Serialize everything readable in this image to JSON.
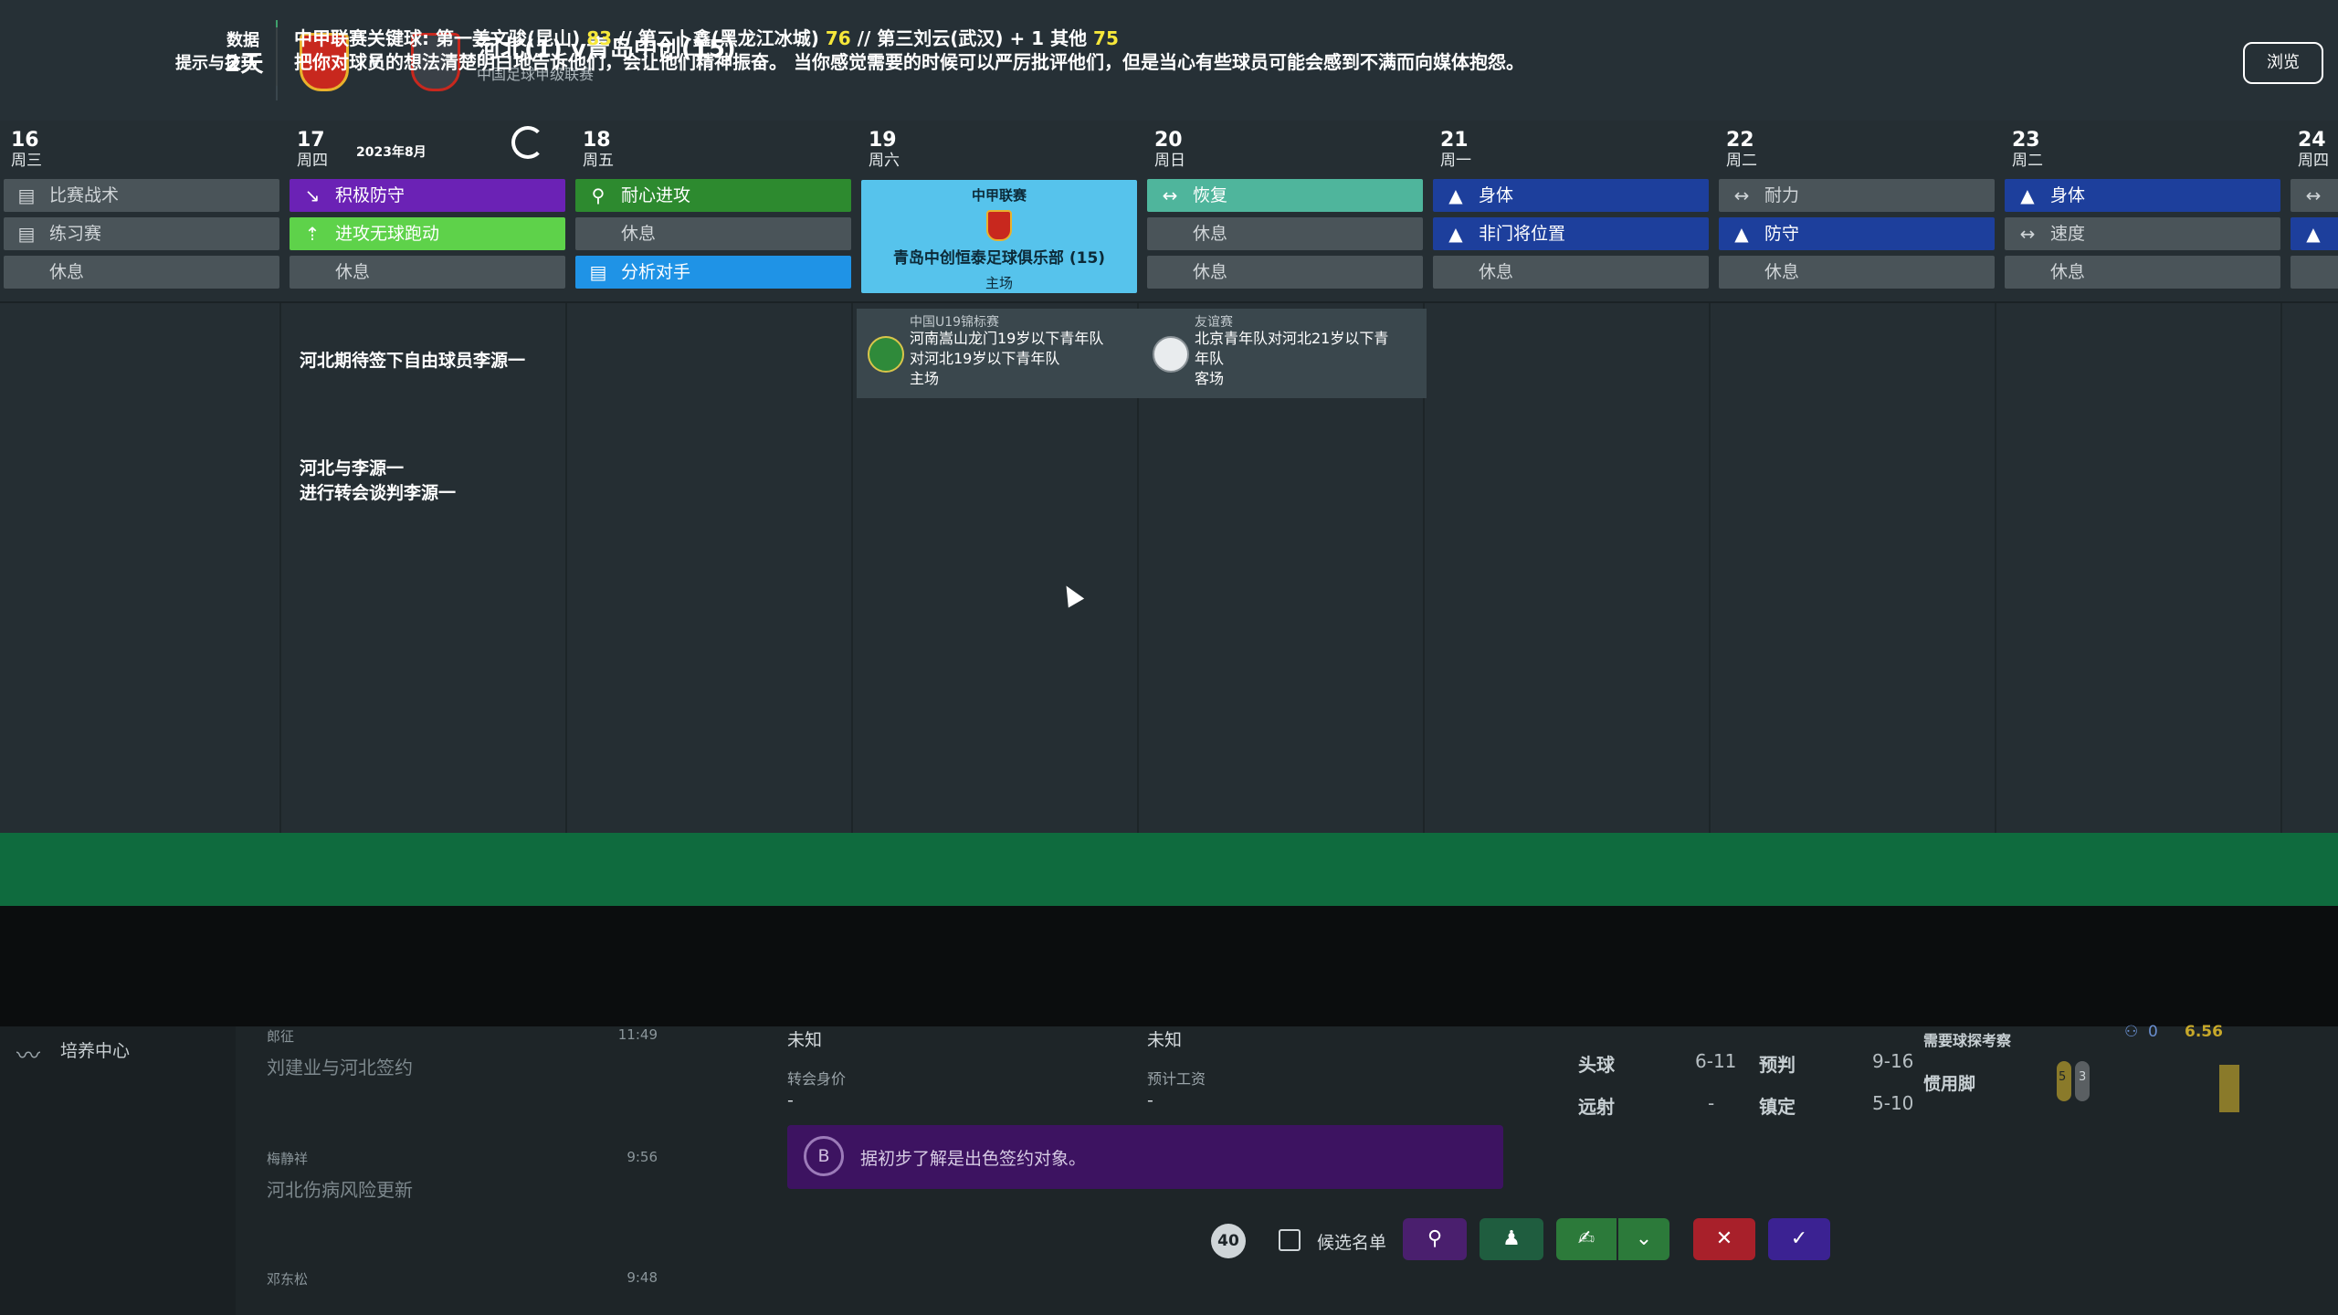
{
  "header": {
    "days_left": "2天",
    "vs": "v",
    "match_title": "河北(1) v青岛中创(15)",
    "league": "中国足球甲级联赛",
    "browse": "浏览",
    "month_label": "2023年8月"
  },
  "calendar": {
    "days": [
      {
        "num": "16",
        "week": "周三",
        "slots": [
          {
            "icon": "clipboard-icon",
            "glyph": "▤",
            "label": "比赛战术",
            "color": "gray"
          },
          {
            "icon": "clipboard-icon",
            "glyph": "▤",
            "label": "练习赛",
            "color": "gray"
          },
          {
            "icon": "",
            "glyph": "",
            "label": "休息",
            "color": "gray"
          }
        ]
      },
      {
        "num": "17",
        "week": "周四",
        "slots": [
          {
            "icon": "tackle-icon",
            "glyph": "↘",
            "label": "积极防守",
            "color": "purple"
          },
          {
            "icon": "run-icon",
            "glyph": "⇡",
            "label": "进攻无球跑动",
            "color": "lime"
          },
          {
            "icon": "",
            "glyph": "",
            "label": "休息",
            "color": "gray"
          }
        ]
      },
      {
        "num": "18",
        "week": "周五",
        "slots": [
          {
            "icon": "run-icon",
            "glyph": "⚲",
            "label": "耐心进攻",
            "color": "green"
          },
          {
            "icon": "",
            "glyph": "",
            "label": "休息",
            "color": "gray"
          },
          {
            "icon": "clipboard-icon",
            "glyph": "▤",
            "label": "分析对手",
            "color": "blue"
          }
        ]
      },
      {
        "num": "19",
        "week": "周六",
        "slots": []
      },
      {
        "num": "20",
        "week": "周日",
        "slots": [
          {
            "icon": "arrows-icon",
            "glyph": "↔",
            "label": "恢复",
            "color": "teal"
          },
          {
            "icon": "",
            "glyph": "",
            "label": "休息",
            "color": "gray"
          },
          {
            "icon": "",
            "glyph": "",
            "label": "休息",
            "color": "gray"
          }
        ]
      },
      {
        "num": "21",
        "week": "周一",
        "slots": [
          {
            "icon": "cone-icon",
            "glyph": "▲",
            "label": "身体",
            "color": "navy"
          },
          {
            "icon": "cone-icon",
            "glyph": "▲",
            "label": "非门将位置",
            "color": "navy"
          },
          {
            "icon": "",
            "glyph": "",
            "label": "休息",
            "color": "gray"
          }
        ]
      },
      {
        "num": "22",
        "week": "周二",
        "slots": [
          {
            "icon": "arrows-icon",
            "glyph": "↔",
            "label": "耐力",
            "color": "gray"
          },
          {
            "icon": "cone-icon",
            "glyph": "▲",
            "label": "防守",
            "color": "navy"
          },
          {
            "icon": "",
            "glyph": "",
            "label": "休息",
            "color": "gray"
          }
        ]
      },
      {
        "num": "23",
        "week": "周二",
        "slots": [
          {
            "icon": "cone-icon",
            "glyph": "▲",
            "label": "身体",
            "color": "navy"
          },
          {
            "icon": "arrows-icon",
            "glyph": "↔",
            "label": "速度",
            "color": "gray"
          },
          {
            "icon": "",
            "glyph": "",
            "label": "休息",
            "color": "gray"
          }
        ]
      },
      {
        "num": "24",
        "week": "周四",
        "slots": [
          {
            "icon": "arrows-icon",
            "glyph": "↔",
            "label": "",
            "color": "gray"
          },
          {
            "icon": "cone-icon",
            "glyph": "▲",
            "label": "",
            "color": "navy"
          },
          {
            "icon": "",
            "glyph": "",
            "label": "",
            "color": "gray"
          }
        ]
      }
    ],
    "match_card": {
      "league": "中甲联赛",
      "opponent": "青岛中创恒泰足球俱乐部 (15)",
      "venue": "主场"
    },
    "news": [
      "河北期待签下自由球员李源一",
      "河北与李源一",
      "进行转会谈判李源一"
    ],
    "fixtures": [
      {
        "comp": "中国U19锦标赛",
        "line1": "河南嵩山龙门19岁以下青年队",
        "line2": "对河北19岁以下青年队",
        "line3": "主场"
      },
      {
        "comp": "友谊赛",
        "line1": "北京青年队对河北21岁以下青",
        "line2": "年队",
        "line3": "客场"
      }
    ]
  },
  "data_bar": {
    "label": "数据",
    "prefix": "中甲联赛关键球: 第一姜文骏(昆山) ",
    "v1": "83",
    "mid1": " // 第二卜鑫(黑龙江冰城) ",
    "v2": "76",
    "mid2": " // 第三刘云(武汉) + 1 其他 ",
    "v3": "75"
  },
  "tips": {
    "label": "提示与技巧",
    "text": "把你对球员的想法清楚明白地告诉他们，会让他们精神振奋。 当你感觉需要的时候可以严厉批评他们，但是当心有些球员可能会感到不满而向媒体抱怨。"
  },
  "bottom": {
    "nav_label": "培养中心",
    "mails": [
      {
        "from": "郎征",
        "time": "11:49",
        "subject": "刘建业与河北签约"
      },
      {
        "from": "梅静祥",
        "time": "9:56",
        "subject": "河北伤病风险更新"
      },
      {
        "from": "邓东松",
        "time": "9:48",
        "subject": ""
      }
    ],
    "fields": {
      "unknown1": "未知",
      "unknown2": "未知",
      "transfer_value_label": "转会身价",
      "transfer_value": "-",
      "wage_label": "预计工资",
      "wage": "-"
    },
    "scout": {
      "badge": "B",
      "text": "据初步了解是出色签约对象。"
    },
    "attributes": [
      {
        "label": "头球",
        "value": "6-11"
      },
      {
        "label": "预判",
        "value": "9-16"
      },
      {
        "label": "远射",
        "value": "-"
      },
      {
        "label": "镇定",
        "value": "5-10"
      }
    ],
    "scout_label": "需要球探考察",
    "foot_label": "惯用脚",
    "foot_left": "5",
    "foot_right": "3",
    "scouts_count": "0",
    "rating": "6.56",
    "toolbar": {
      "count": "40",
      "shortlist": "候选名单"
    }
  }
}
